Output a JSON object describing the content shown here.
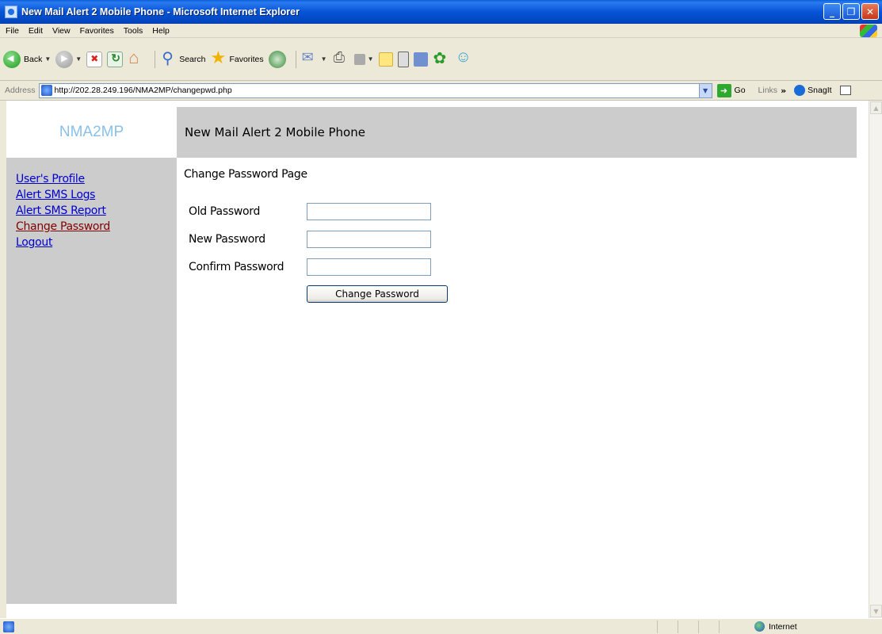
{
  "window": {
    "title": "New Mail Alert 2 Mobile Phone - Microsoft Internet Explorer",
    "buttons": [
      "minimize",
      "maximize",
      "close"
    ]
  },
  "menu": [
    "File",
    "Edit",
    "View",
    "Favorites",
    "Tools",
    "Help"
  ],
  "toolbar": {
    "back_label": "Back",
    "search_label": "Search",
    "favorites_label": "Favorites"
  },
  "address": {
    "label": "Address",
    "url": "http://202.28.249.196/NMA2MP/changepwd.php",
    "go_label": "Go",
    "links_label": "Links",
    "snagit_label": "SnagIt"
  },
  "site": {
    "logo": "NMA2MP",
    "header": "New Mail Alert 2 Mobile Phone",
    "sidebar": [
      {
        "label": "User's Profile"
      },
      {
        "label": "Alert SMS Logs"
      },
      {
        "label": "Alert SMS Report"
      },
      {
        "label": "Change Password"
      },
      {
        "label": "Logout"
      }
    ],
    "page_heading": "Change Password Page",
    "form": {
      "old_password_label": "Old Password",
      "new_password_label": "New Password",
      "confirm_password_label": "Confirm Password",
      "old_password_value": "",
      "new_password_value": "",
      "confirm_password_value": "",
      "submit_label": "Change Password"
    }
  },
  "status": {
    "zone": "Internet"
  },
  "colors": {
    "titlebar": "#0654d6",
    "chrome": "#ece9d8",
    "panel_gray": "#cccccc",
    "link": "#0000cc",
    "visited_link": "#800000",
    "logo_text": "#8ac0e8"
  }
}
